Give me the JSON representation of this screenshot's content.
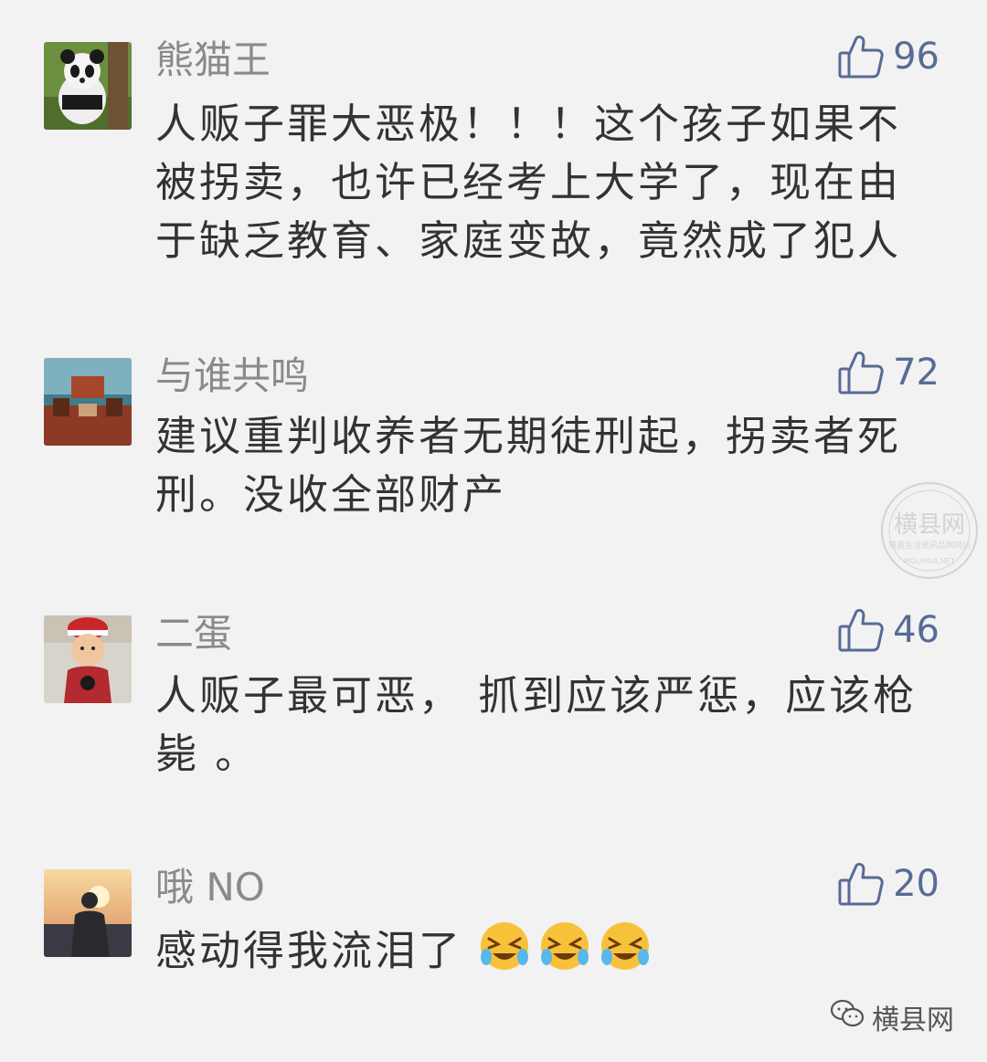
{
  "comments": [
    {
      "nickname": "熊猫王",
      "likes": "96",
      "text": "人贩子罪大恶极！！！这个孩子如果不被拐卖，也许已经考上大学了，现在由于缺乏教育、家庭变故，竟然成了犯人",
      "avatar": "panda-avatar"
    },
    {
      "nickname": "与谁共鸣",
      "likes": "72",
      "text": "建议重判收养者无期徒刑起，拐卖者死刑。没收全部财产",
      "avatar": "room-avatar"
    },
    {
      "nickname": "二蛋",
      "likes": "46",
      "text": "人贩子最可恶， 抓到应该严惩，应该枪毙 。",
      "avatar": "child-avatar"
    },
    {
      "nickname": "哦 NO",
      "likes": "20",
      "text": "感动得我流泪了",
      "emojis": [
        "crying-laughing-emoji",
        "crying-laughing-emoji",
        "crying-laughing-emoji"
      ],
      "avatar": "sunset-avatar"
    }
  ],
  "watermark": {
    "line1": "横县网",
    "line2": "横县生活资讯品牌网站",
    "line3": "MOLIHUA.NET"
  },
  "brand": {
    "label": "横县网"
  },
  "colors": {
    "background": "#f2f2f2",
    "nickname": "#8a8a8a",
    "like": "#576b95",
    "text": "#333333"
  }
}
